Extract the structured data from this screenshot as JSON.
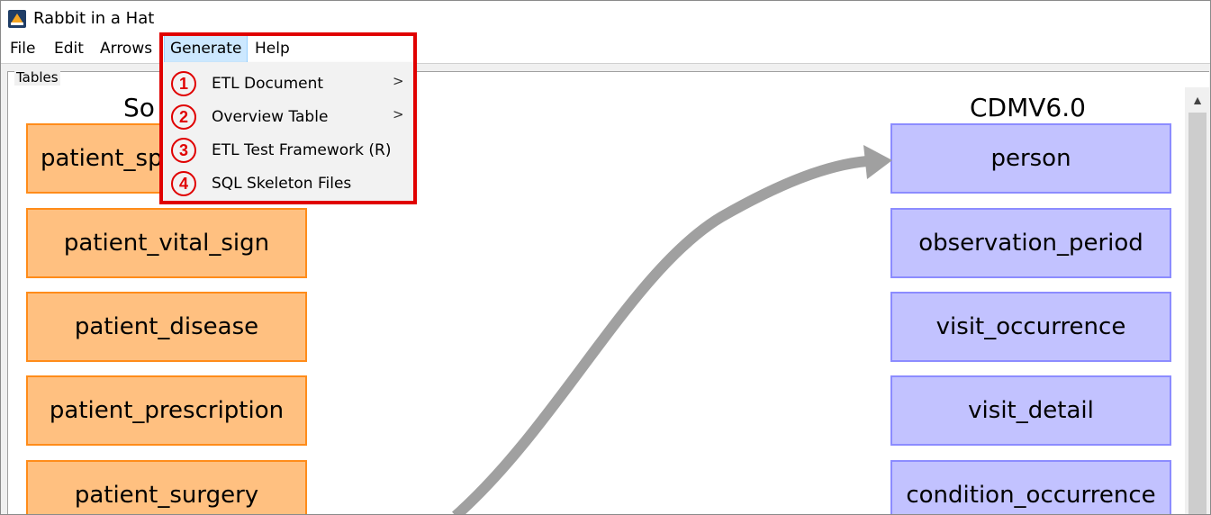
{
  "window": {
    "title": "Rabbit in a Hat"
  },
  "menubar": {
    "items": [
      {
        "label": "File"
      },
      {
        "label": "Edit"
      },
      {
        "label": "Arrows"
      },
      {
        "label": "Generate"
      },
      {
        "label": "Help"
      }
    ]
  },
  "generate_menu": {
    "items": [
      {
        "number": "1",
        "label": "ETL Document",
        "submenu": ">"
      },
      {
        "number": "2",
        "label": "Overview Table",
        "submenu": ">"
      },
      {
        "number": "3",
        "label": "ETL Test Framework (R)"
      },
      {
        "number": "4",
        "label": "SQL Skeleton Files"
      }
    ]
  },
  "tables_panel": {
    "label": "Tables",
    "source_header": "So",
    "target_header": "CDMV6.0",
    "source_tables": [
      {
        "label": "patient_spe"
      },
      {
        "label": "patient_vital_sign"
      },
      {
        "label": "patient_disease"
      },
      {
        "label": "patient_prescription"
      },
      {
        "label": "patient_surgery"
      }
    ],
    "target_tables": [
      {
        "label": "person"
      },
      {
        "label": "observation_period"
      },
      {
        "label": "visit_occurrence"
      },
      {
        "label": "visit_detail"
      },
      {
        "label": "condition_occurrence"
      }
    ]
  },
  "colors": {
    "source_fill": "#ffc080",
    "source_border": "#ff8c1a",
    "target_fill": "#c2c2ff",
    "target_border": "#8c8cff",
    "highlight": "#e00000",
    "arrow": "#a0a0a0"
  }
}
